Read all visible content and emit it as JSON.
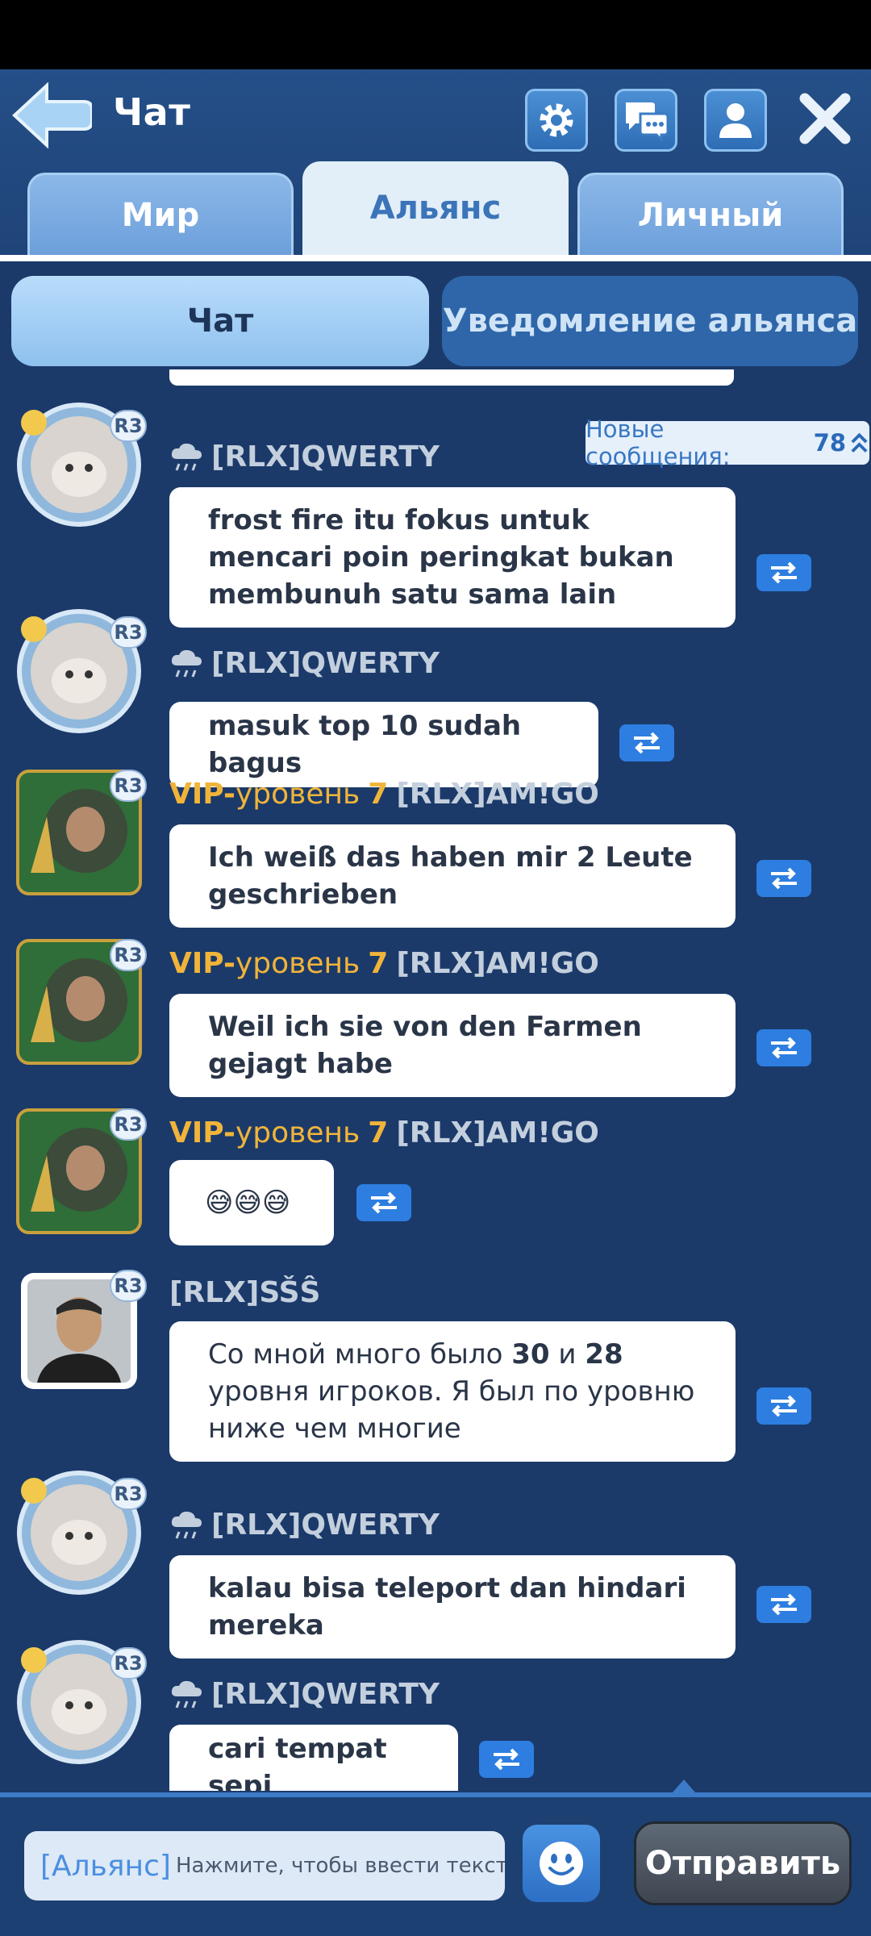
{
  "header": {
    "title": "Чат",
    "icons": [
      "back-arrow-icon",
      "gear-icon",
      "chat-bubbles-icon",
      "person-icon",
      "close-icon"
    ]
  },
  "tabs": [
    {
      "label": "Мир",
      "active": false
    },
    {
      "label": "Альянс",
      "active": true
    },
    {
      "label": "Личный",
      "active": false
    }
  ],
  "subtabs": [
    {
      "label": "Чат",
      "active": true
    },
    {
      "label": "Уведомление альянса",
      "active": false
    }
  ],
  "new_messages": {
    "label": "Новые сообщения:",
    "count": "78"
  },
  "messages": [
    {
      "rank": "R3",
      "vip": "",
      "vip_word": "",
      "vip_level": "",
      "name": "[RLX]QWERTY",
      "text": "frost fire itu fokus untuk mencari poin peringkat bukan membunuh satu sama lain"
    },
    {
      "rank": "R3",
      "vip": "",
      "vip_word": "",
      "vip_level": "",
      "name": "[RLX]QWERTY",
      "text": "masuk top 10 sudah bagus"
    },
    {
      "rank": "R3",
      "vip": "VIP-",
      "vip_word": "уровень",
      "vip_level": "7",
      "name": "[RLX]AM!GO",
      "text": "Ich weiß das haben mir 2 Leute geschrieben"
    },
    {
      "rank": "R3",
      "vip": "VIP-",
      "vip_word": "уровень",
      "vip_level": "7",
      "name": "[RLX]AM!GO",
      "text": "Weil ich sie von den Farmen gejagt habe"
    },
    {
      "rank": "R3",
      "vip": "VIP-",
      "vip_word": "уровень",
      "vip_level": "7",
      "name": "[RLX]AM!GO",
      "text": "😅😅😅"
    },
    {
      "rank": "R3",
      "vip": "",
      "vip_word": "",
      "vip_level": "",
      "name": "[RLX]SŠŜ",
      "text_parts": [
        "Со мной много было ",
        "30",
        " и ",
        "28",
        " уровня игроков. Я был по уровню ниже чем многие"
      ]
    },
    {
      "rank": "R3",
      "vip": "",
      "vip_word": "",
      "vip_level": "",
      "name": "[RLX]QWERTY",
      "text": "kalau bisa teleport dan hindari mereka"
    },
    {
      "rank": "R3",
      "vip": "",
      "vip_word": "",
      "vip_level": "",
      "name": "[RLX]QWERTY",
      "text": "cari tempat sepi"
    }
  ],
  "composer": {
    "tag": "[Альянс]",
    "placeholder": "Нажмите, чтобы ввести текст",
    "send_label": "Отправить"
  },
  "colors": {
    "background": "#1b3a6a",
    "accent": "#2d7ee0",
    "vip": "#f0b43a",
    "send": "#4a525d"
  }
}
